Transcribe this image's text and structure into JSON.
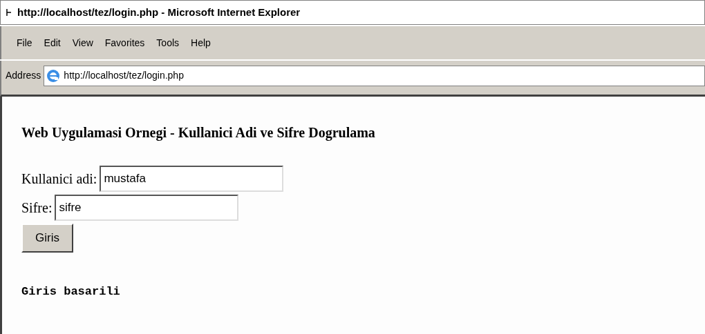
{
  "window": {
    "title": "http://localhost/tez/login.php - Microsoft Internet Explorer"
  },
  "menu": [
    "File",
    "Edit",
    "View",
    "Favorites",
    "Tools",
    "Help"
  ],
  "address_bar": {
    "label": "Address",
    "value": "http://localhost/tez/login.php"
  },
  "page": {
    "heading": "Web Uygulamasi Ornegi - Kullanici Adi ve Sifre Dogrulama",
    "fields": [
      {
        "label": "Kullanici adi:",
        "value": "mustafa"
      },
      {
        "label": "Sifre:",
        "value": "sifre"
      }
    ],
    "button": "Giris",
    "result": "Giris basarili"
  }
}
